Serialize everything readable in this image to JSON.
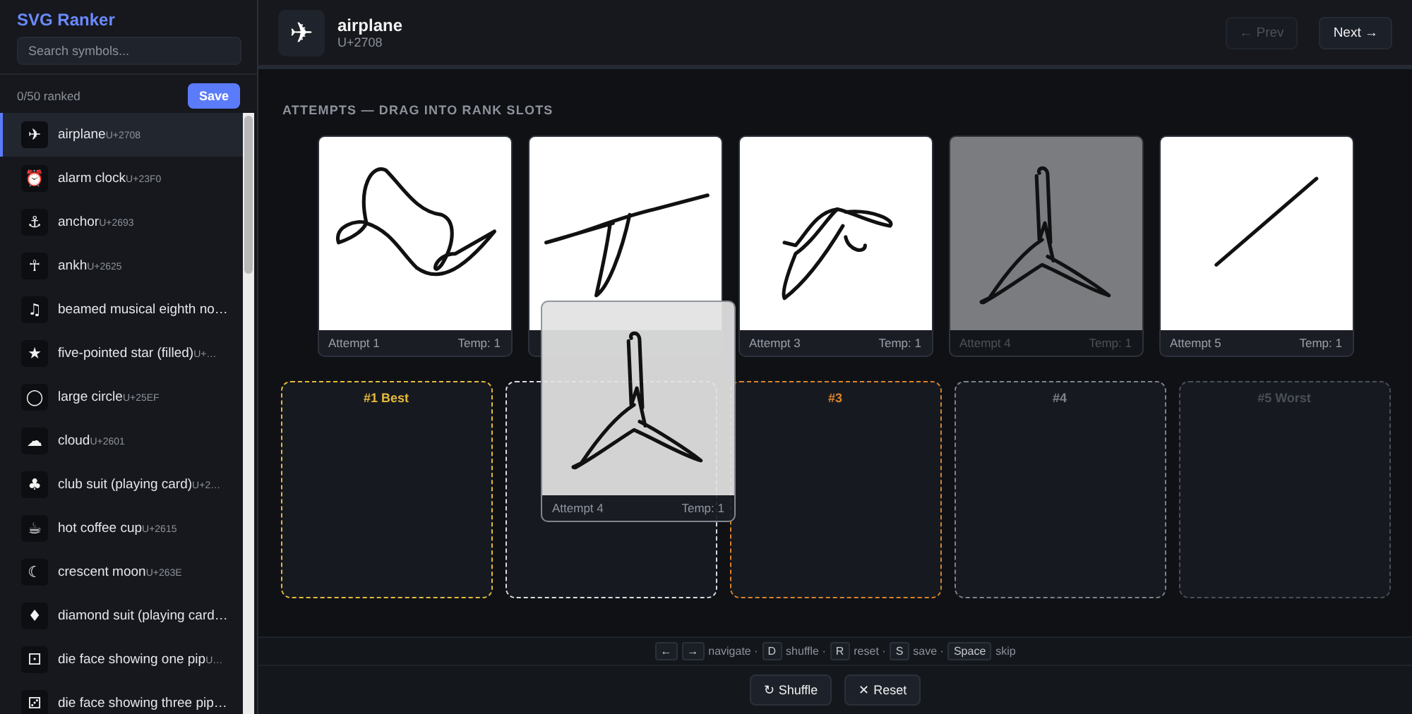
{
  "sidebar": {
    "title": "SVG Ranker",
    "search": {
      "placeholder": "Search symbols..."
    },
    "progress": "0/50 ranked",
    "save_button": "Save",
    "items": [
      {
        "glyph": "✈",
        "name": "airplane",
        "code": "U+2708",
        "selected": true
      },
      {
        "glyph": "⏰",
        "name": "alarm clock",
        "code": "U+23F0",
        "selected": false
      },
      {
        "glyph": "⚓",
        "name": "anchor",
        "code": "U+2693",
        "selected": false
      },
      {
        "glyph": "☥",
        "name": "ankh",
        "code": "U+2625",
        "selected": false
      },
      {
        "glyph": "♫",
        "name": "beamed musical eighth no…",
        "selected": false
      },
      {
        "glyph": "★",
        "name": "five-pointed star (filled)",
        "code": "U+…",
        "selected": false
      },
      {
        "glyph": "◯",
        "name": "large circle",
        "code": "U+25EF",
        "selected": false
      },
      {
        "glyph": "☁",
        "name": "cloud",
        "code": "U+2601",
        "selected": false
      },
      {
        "glyph": "♣",
        "name": "club suit (playing card)",
        "code": "U+2…",
        "selected": false
      },
      {
        "glyph": "☕",
        "name": "hot coffee cup",
        "code": "U+2615",
        "selected": false
      },
      {
        "glyph": "☾",
        "name": "crescent moon",
        "code": "U+263E",
        "selected": false
      },
      {
        "glyph": "♦",
        "name": "diamond suit (playing card…",
        "selected": false
      },
      {
        "glyph": "⚀",
        "name": "die face showing one pip",
        "code": "U…",
        "selected": false
      },
      {
        "glyph": "⚂",
        "name": "die face showing three pip…",
        "selected": false
      }
    ]
  },
  "header": {
    "glyph": "✈",
    "name": "airplane",
    "code": "U+2708",
    "prev": {
      "label": "← Prev",
      "disabled": true
    },
    "next": {
      "label": "Next →",
      "disabled": false
    }
  },
  "section_title": "ATTEMPTS — DRAG INTO RANK SLOTS",
  "attempts": [
    {
      "label": "Attempt 1",
      "temp": "Temp: 1",
      "dragging": false
    },
    {
      "dragging": false
    },
    {
      "label": "Attempt 3",
      "temp": "Temp: 1",
      "dragging": false
    },
    {
      "label": "Attempt 4",
      "temp": "Temp: 1",
      "dragging": true
    },
    {
      "label": "Attempt 5",
      "temp": "Temp: 1",
      "dragging": false
    }
  ],
  "slots": [
    {
      "label": "#1 Best",
      "color": "#e5b93c"
    },
    {
      "color": "#d8dbe0"
    },
    {
      "label": "#3",
      "color": "#d9822b"
    },
    {
      "label": "#4",
      "color": "#7d828b"
    },
    {
      "label": "#5 Worst",
      "color": "#4a4f57"
    }
  ],
  "drag_ghost": {
    "label": "Attempt 4",
    "temp": "Temp: 1"
  },
  "shortcuts": [
    {
      "kind": "key",
      "text": "←"
    },
    {
      "kind": "key",
      "text": "→"
    },
    {
      "kind": "text",
      "text": "navigate ·"
    },
    {
      "kind": "key",
      "text": "D"
    },
    {
      "kind": "text",
      "text": "shuffle ·"
    },
    {
      "kind": "key",
      "text": "R"
    },
    {
      "kind": "text",
      "text": "reset ·"
    },
    {
      "kind": "key",
      "text": "S"
    },
    {
      "kind": "text",
      "text": "save ·"
    },
    {
      "kind": "key",
      "text": "Space"
    },
    {
      "kind": "text",
      "text": "skip"
    }
  ],
  "actions": [
    "↻ Shuffle",
    "✕ Reset"
  ]
}
